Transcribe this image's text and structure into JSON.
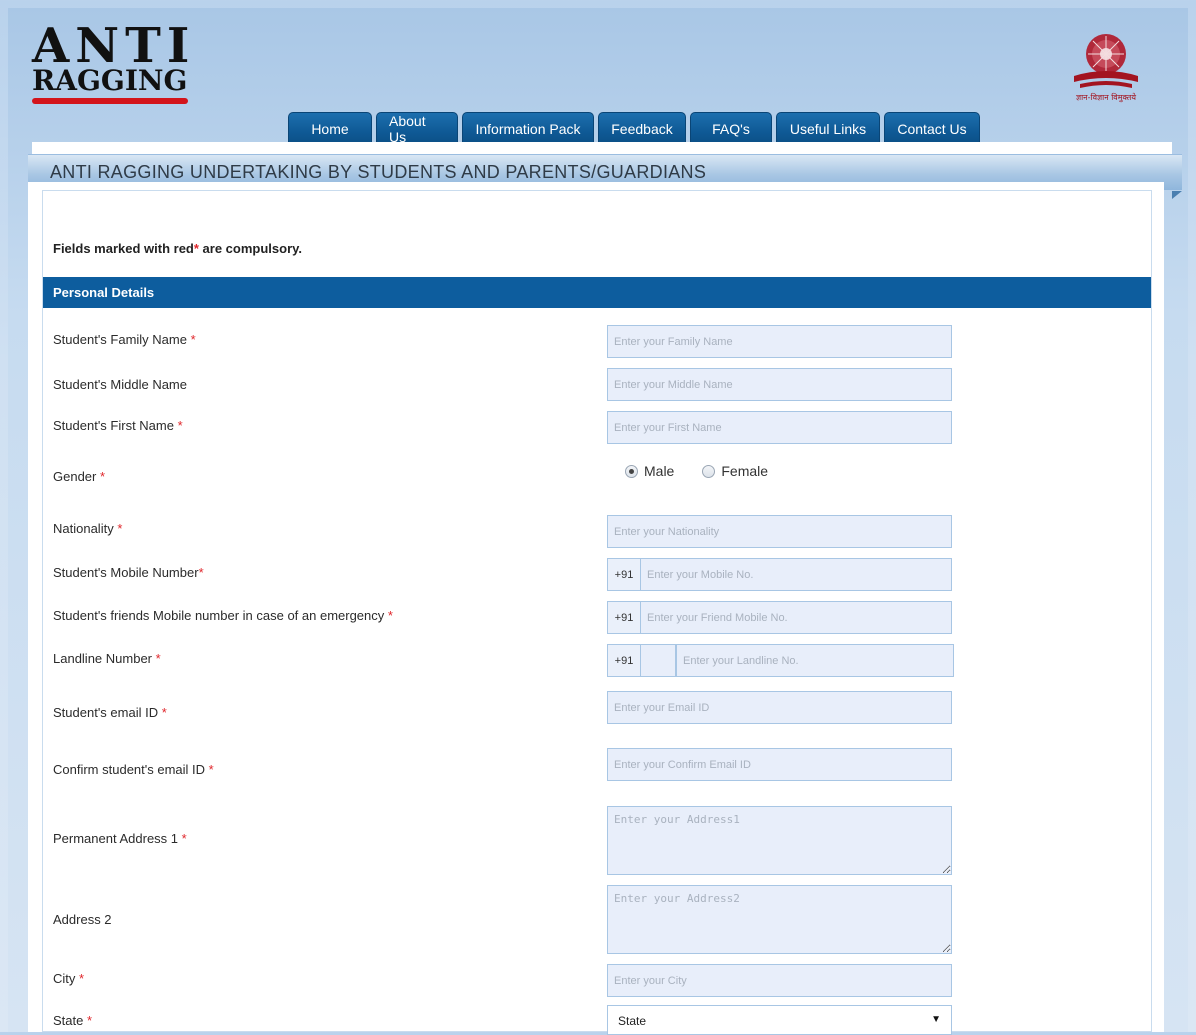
{
  "logo": {
    "line1": "ANTI",
    "line2": "RAGGING"
  },
  "emblem": {
    "caption": "ज्ञान-विज्ञान विमुक्तये"
  },
  "nav": [
    "Home",
    "About Us",
    "Information Pack",
    "Feedback",
    "FAQ's",
    "Useful Links",
    "Contact Us"
  ],
  "page_title": "ANTI RAGGING UNDERTAKING BY STUDENTS AND PARENTS/GUARDIANS",
  "note": {
    "prefix": "Fields marked with red",
    "star": "*",
    "suffix": " are compulsory."
  },
  "section": "Personal Details",
  "required_mark": "*",
  "fields": {
    "family_name": {
      "label": "Student's Family Name",
      "placeholder": "Enter your Family Name"
    },
    "middle_name": {
      "label": "Student's Middle Name",
      "placeholder": "Enter your Middle Name"
    },
    "first_name": {
      "label": "Student's First Name",
      "placeholder": "Enter your First Name"
    },
    "gender": {
      "label": "Gender",
      "options": [
        "Male",
        "Female"
      ],
      "selected": "Male"
    },
    "nationality": {
      "label": "Nationality",
      "placeholder": "Enter your Nationality"
    },
    "mobile": {
      "label": "Student's Mobile Number",
      "prefix": "+91",
      "placeholder": "Enter your Mobile No."
    },
    "friend_mobile": {
      "label": "Student's friends Mobile number in case of an emergency",
      "prefix": "+91",
      "placeholder": "Enter your Friend Mobile No."
    },
    "landline": {
      "label": "Landline Number",
      "prefix": "+91",
      "placeholder": "Enter your Landline No."
    },
    "email": {
      "label": "Student's email ID",
      "placeholder": "Enter your Email ID"
    },
    "confirm_email": {
      "label": "Confirm student's email ID",
      "placeholder": "Enter your Confirm Email ID"
    },
    "address1": {
      "label": "Permanent Address 1",
      "placeholder": "Enter your Address1"
    },
    "address2": {
      "label": "Address 2",
      "placeholder": "Enter your Address2"
    },
    "city": {
      "label": "City",
      "placeholder": "Enter your City"
    },
    "state": {
      "label": "State",
      "value": "State"
    }
  }
}
